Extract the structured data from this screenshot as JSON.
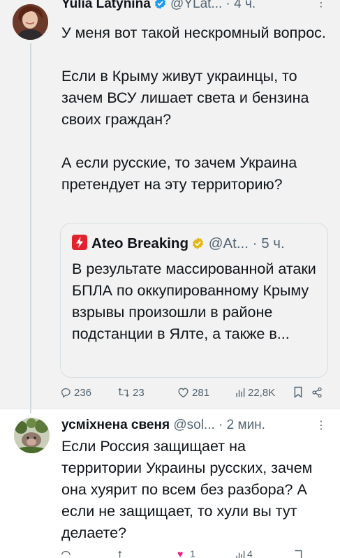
{
  "tweet": {
    "author_name": "Yulia Latynina",
    "handle": "@YLat...",
    "separator": "·",
    "time": "4 ч.",
    "paragraphs": [
      "У меня вот такой нескромный вопрос.",
      "Если в Крыму живут украинцы, то зачем ВСУ лишает света и бензина своих граждан?",
      "А если русские, то зачем Украина претендует на эту территорию?"
    ],
    "quote": {
      "author_name": "Ateo Breaking",
      "handle": "@At...",
      "separator": "·",
      "time": "5 ч.",
      "text": "В результате массированной атаки БПЛА по оккупированному Крыму взрывы произошли в районе подстанции в Ялте, а также в..."
    },
    "actions": {
      "replies": "236",
      "reposts": "23",
      "likes": "281",
      "views": "22,8K"
    }
  },
  "reply": {
    "author_name": "усміхнена свеня",
    "handle": "@sol...",
    "separator": "·",
    "time": "2 мин.",
    "text": "Если Россия защищает на территории Украины русских, зачем она хуярит по всем без разбора? А если не защищает, то хули вы тут делаете?",
    "partial_counts": [
      "1",
      "4"
    ]
  },
  "colors": {
    "accent_blue": "#1d9bf0",
    "verified_gold": "#e2b719",
    "text_primary": "#0f1419",
    "text_secondary": "#536471",
    "like_pink": "#f91880"
  }
}
